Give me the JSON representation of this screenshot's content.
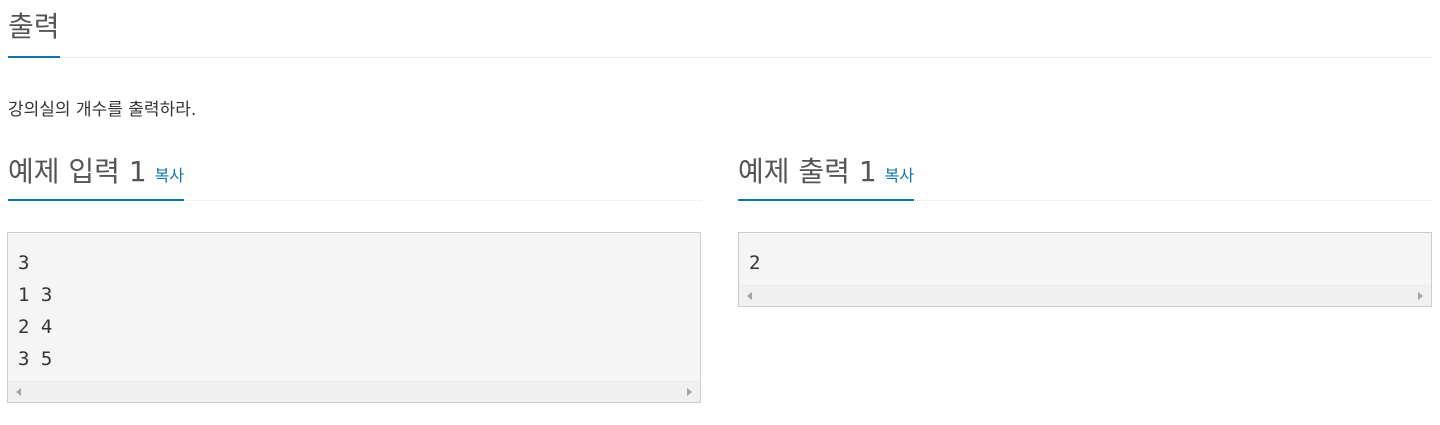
{
  "output_section": {
    "title": "출력",
    "description": "강의실의 개수를 출력하라."
  },
  "sample_input": {
    "title": "예제 입력 1",
    "copy_label": "복사",
    "lines": "3\n1 3\n2 4\n3 5"
  },
  "sample_output": {
    "title": "예제 출력 1",
    "copy_label": "복사",
    "lines": "2"
  },
  "colors": {
    "accent": "#0e76a8",
    "box_background": "#f5f5f5",
    "box_border": "#cccccc"
  },
  "icons": [
    "scroll-left-arrow-icon",
    "scroll-right-arrow-icon"
  ]
}
